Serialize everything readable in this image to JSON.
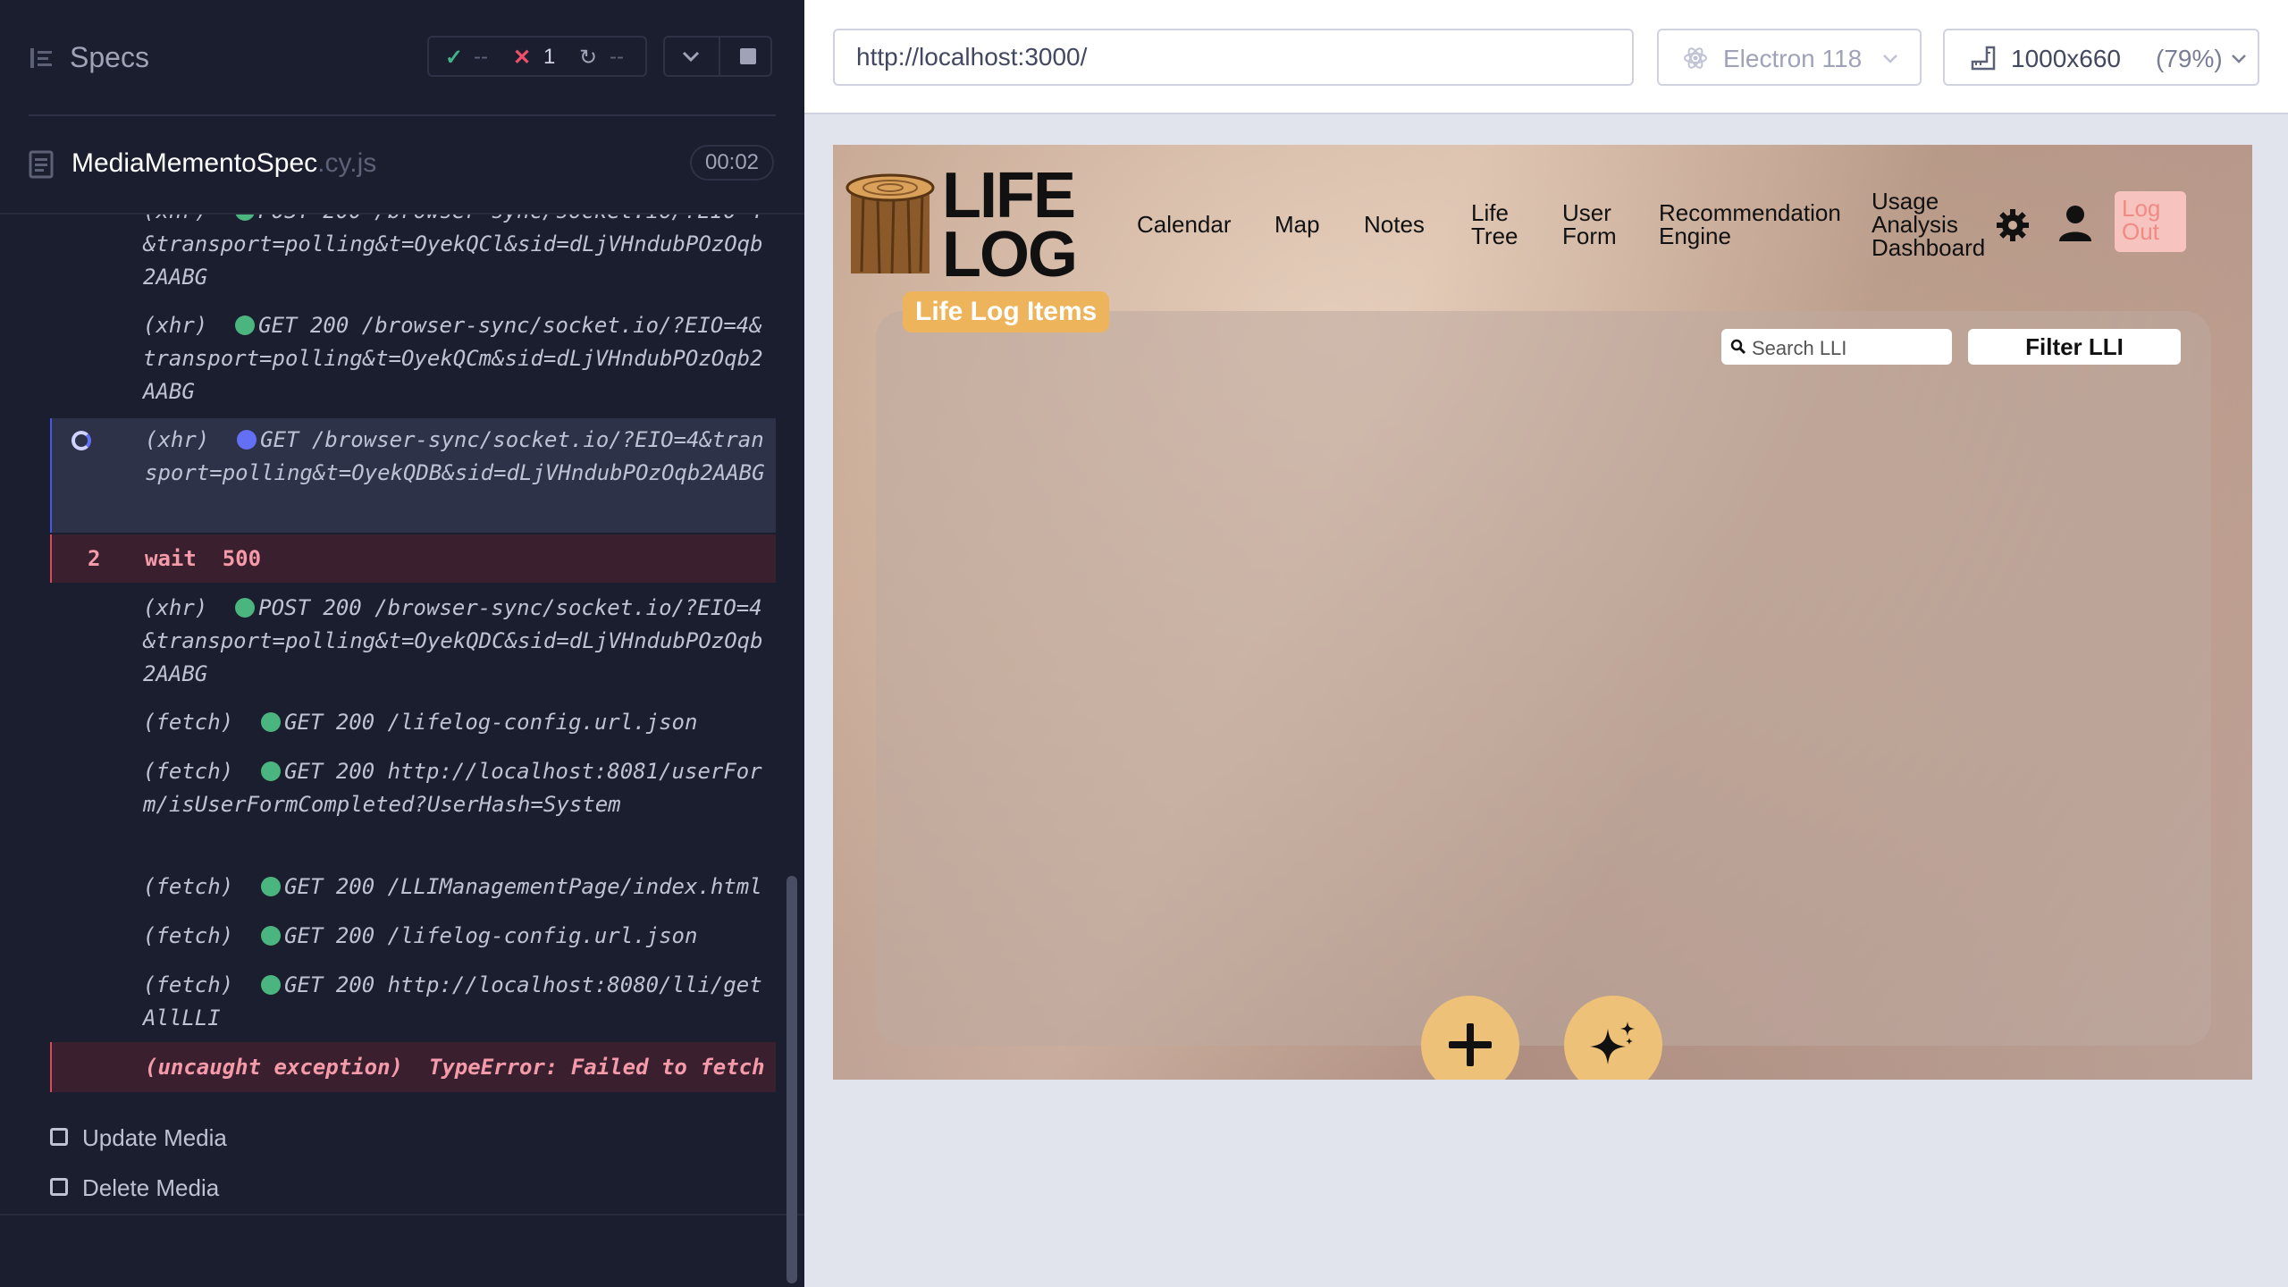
{
  "reporter": {
    "specs_title": "Specs",
    "stats": {
      "passed": "--",
      "failed": "1",
      "pending": "--"
    },
    "spec": {
      "name": "MediaMementoSpec",
      "ext": ".cy.js",
      "duration": "00:02"
    },
    "commands": [
      {
        "type": "(xhr)",
        "dot": "green",
        "text": "POST 200 /browser-sync/socket.io/?EIO=4&transport=polling&t=OyekQCl&sid=dLjVHndubPOzOqb2AABG"
      },
      {
        "type": "(xhr)",
        "dot": "green",
        "text": "GET 200 /browser-sync/socket.io/?EIO=4&transport=polling&t=OyekQCm&sid=dLjVHndubPOzOqb2AABG"
      },
      {
        "type": "(xhr)",
        "dot": "blue",
        "text": "GET /browser-sync/socket.io/?EIO=4&transport=polling&t=OyekQDB&sid=dLjVHndubPOzOqb2AABG"
      },
      {
        "num": "2",
        "text": "wait  500"
      },
      {
        "type": "(xhr)",
        "dot": "green",
        "text": "POST 200 /browser-sync/socket.io/?EIO=4&transport=polling&t=OyekQDC&sid=dLjVHndubPOzOqb2AABG"
      },
      {
        "type": "(fetch)",
        "dot": "green",
        "text": "GET 200 /lifelog-config.url.json"
      },
      {
        "type": "(fetch)",
        "dot": "green",
        "text": "GET 200 http://localhost:8081/userForm/isUserFormCompleted?UserHash=System"
      },
      {
        "type": "(fetch)",
        "dot": "green",
        "text": "GET 200 /LLIManagementPage/index.html"
      },
      {
        "type": "(fetch)",
        "dot": "green",
        "text": "GET 200 /lifelog-config.url.json"
      },
      {
        "type": "(fetch)",
        "dot": "green",
        "text": "GET 200 http://localhost:8080/lli/getAllLLI"
      },
      {
        "type": "(uncaught exception)",
        "text": "TypeError: Failed to fetch"
      }
    ],
    "tests": [
      "Update Media",
      "Delete Media"
    ]
  },
  "topbar": {
    "url": "http://localhost:3000/",
    "browser": "Electron 118",
    "viewport": "1000x660",
    "zoom": "(79%)"
  },
  "app": {
    "logo_line1": "LIFE",
    "logo_line2": "LOG",
    "nav": {
      "calendar": "Calendar",
      "map": "Map",
      "notes": "Notes",
      "life_tree_1": "Life",
      "life_tree_2": "Tree",
      "user_form_1": "User",
      "user_form_2": "Form",
      "rec_1": "Recommendation",
      "rec_2": "Engine",
      "usage_1": "Usage",
      "usage_2": "Analysis",
      "usage_3": "Dashboard",
      "logout_1": "Log",
      "logout_2": "Out"
    },
    "section_title": "Life Log Items",
    "search_placeholder": "Search LLI",
    "filter_label": "Filter LLI",
    "accent": "#edb45c",
    "fab_color": "#edc178"
  }
}
